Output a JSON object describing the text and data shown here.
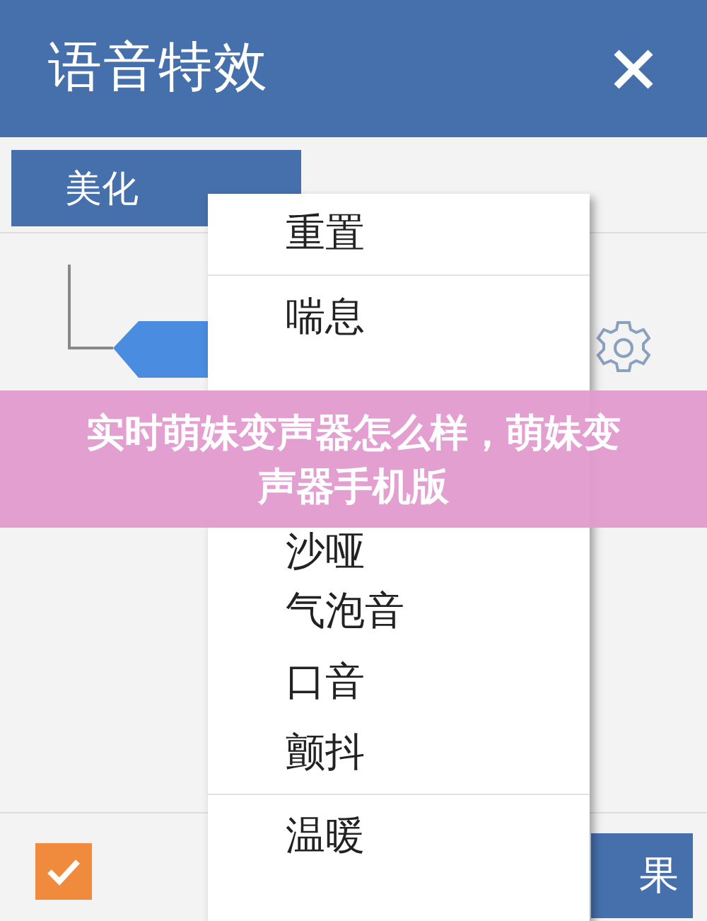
{
  "window": {
    "title": "语音特效"
  },
  "effect_dropdown": {
    "label": "美化",
    "expanded": true
  },
  "menu": {
    "groups": [
      {
        "items": [
          {
            "label": "重置"
          }
        ]
      },
      {
        "items": [
          {
            "label": "喘息"
          },
          {
            "label": "沙哑"
          },
          {
            "label": "气泡音"
          },
          {
            "label": "口音"
          },
          {
            "label": "颤抖"
          }
        ]
      },
      {
        "items": [
          {
            "label": "温暖"
          }
        ]
      }
    ]
  },
  "footer": {
    "checkbox": {
      "checked": true
    },
    "button": {
      "label": "果"
    }
  },
  "banner": {
    "text": "实时萌妹变声器怎么样，萌妹变声器手机版"
  }
}
